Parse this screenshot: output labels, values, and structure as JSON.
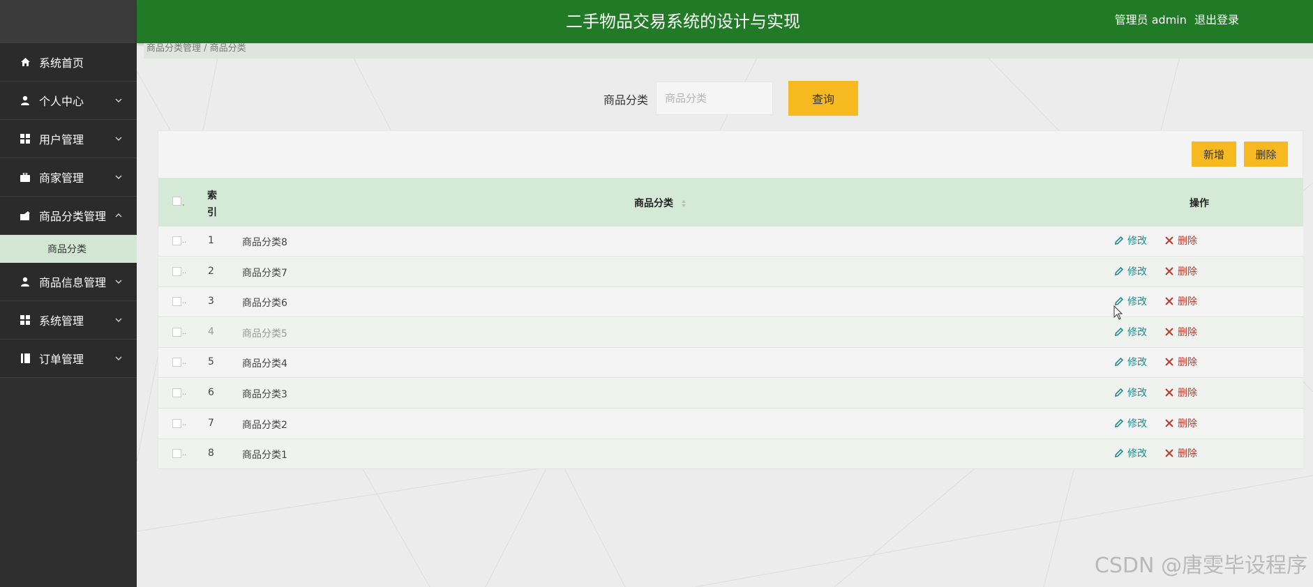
{
  "header": {
    "title": "二手物品交易系统的设计与实现",
    "user": "管理员 admin",
    "logout": "退出登录"
  },
  "breadcrumb": "商品分类管理 / 商品分类",
  "sidebar": {
    "items": [
      {
        "label": "系统首页",
        "icon": "home-icon"
      },
      {
        "label": "个人中心",
        "icon": "user-icon"
      },
      {
        "label": "用户管理",
        "icon": "grid-icon"
      },
      {
        "label": "商家管理",
        "icon": "briefcase-icon"
      },
      {
        "label": "商品分类管理",
        "icon": "tag-icon"
      },
      {
        "label": "商品信息管理",
        "icon": "user-icon"
      },
      {
        "label": "系统管理",
        "icon": "grid-icon"
      },
      {
        "label": "订单管理",
        "icon": "book-icon"
      }
    ],
    "submenu": {
      "label": "商品分类"
    }
  },
  "search": {
    "label": "商品分类",
    "placeholder": "商品分类",
    "button": "查询"
  },
  "toolbar": {
    "add": "新增",
    "delete": "删除"
  },
  "table": {
    "columns": {
      "index": "索引",
      "category": "商品分类",
      "actions": "操作"
    },
    "rows": [
      {
        "index": "1",
        "name": "商品分类8"
      },
      {
        "index": "2",
        "name": "商品分类7"
      },
      {
        "index": "3",
        "name": "商品分类6"
      },
      {
        "index": "4",
        "name": "商品分类5"
      },
      {
        "index": "5",
        "name": "商品分类4"
      },
      {
        "index": "6",
        "name": "商品分类3"
      },
      {
        "index": "7",
        "name": "商品分类2"
      },
      {
        "index": "8",
        "name": "商品分类1"
      }
    ],
    "edit_label": "修改",
    "delete_label": "删除"
  },
  "watermark": "CSDN @唐雯毕设程序",
  "colors": {
    "header": "#217a25",
    "sidebar": "#2f2f2f",
    "accent": "#f6ba20",
    "edit": "#1e8a8a",
    "delete": "#c0392b"
  }
}
